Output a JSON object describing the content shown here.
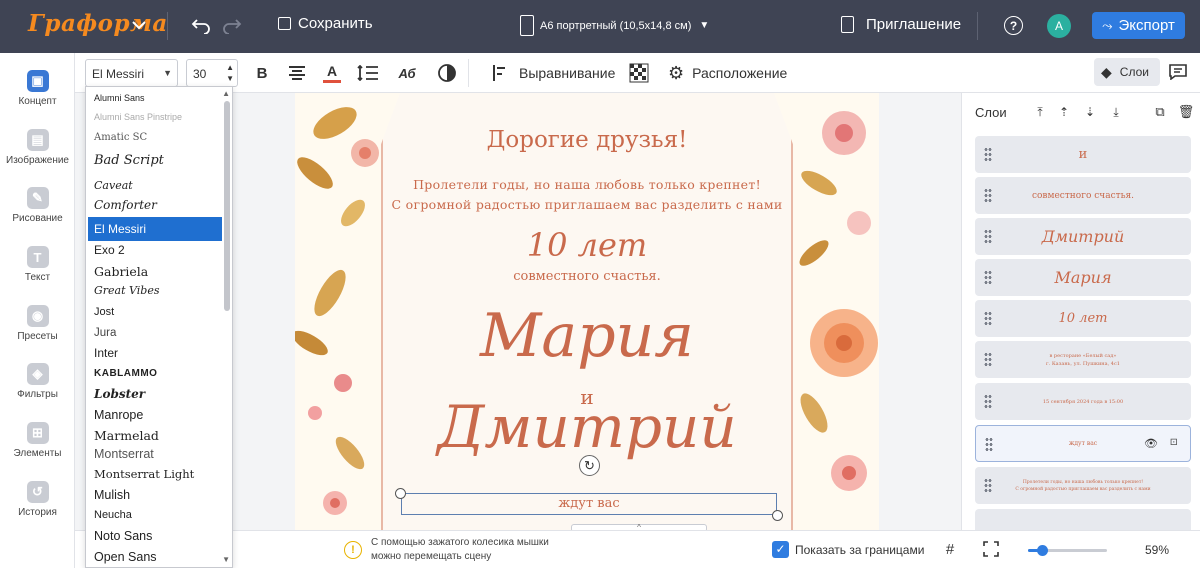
{
  "topbar": {
    "logo": "Граформа",
    "save_label": "Сохранить",
    "format_label": "А6 портретный (10,5х14,8 см)",
    "doc_name": "Приглашение",
    "help_glyph": "?",
    "avatar_letter": "A",
    "export_label": "Экспорт"
  },
  "toolbar": {
    "font_name": "El Messiri",
    "font_size": "30",
    "bold_glyph": "B",
    "align_label": "Выравнивание",
    "arrange_label": "Расположение",
    "layers_label": "Слои"
  },
  "leftnav": [
    {
      "label": "Концепт",
      "icon": "concept-icon"
    },
    {
      "label": "Изображение",
      "icon": "image-icon"
    },
    {
      "label": "Рисование",
      "icon": "draw-icon"
    },
    {
      "label": "Текст",
      "icon": "text-icon"
    },
    {
      "label": "Пресеты",
      "icon": "presets-icon"
    },
    {
      "label": "Фильтры",
      "icon": "filters-icon"
    },
    {
      "label": "Элементы",
      "icon": "elements-icon"
    },
    {
      "label": "История",
      "icon": "history-icon"
    }
  ],
  "font_list": [
    "Alumni Sans",
    "Alumni Sans Pinstripe",
    "Amatic SC",
    "Bad Script",
    "Caveat",
    "Comforter",
    "El Messiri",
    "Exo 2",
    "Gabriela",
    "Great Vibes",
    "Jost",
    "Jura",
    "Inter",
    "KABLAMMO",
    "Lobster",
    "Manrope",
    "Marmelad",
    "Montserrat",
    "Montserrat Light",
    "Mulish",
    "Neucha",
    "Noto Sans",
    "Open Sans"
  ],
  "font_selected_index": 6,
  "card": {
    "greeting": "Дорогие друзья!",
    "intro_line1": "Пролетели годы, но наша любовь только крепнет!",
    "intro_line2": "С огромной радостью приглашаем вас разделить с нами",
    "years": "10 лет",
    "together": "совместного счастья.",
    "name1": "Мария",
    "conj": "и",
    "name2": "Дмитрий",
    "waiting": "ждут вас"
  },
  "layers_panel": {
    "title": "Слои",
    "items": [
      {
        "text": "и"
      },
      {
        "text": "совместного счастья."
      },
      {
        "text": "Дмитрий"
      },
      {
        "text": "Мария"
      },
      {
        "text": "10 лет"
      },
      {
        "text": "в ресторане «Белый сад»\nг. Казань, ул. Пушкина, 4с1"
      },
      {
        "text": "15 сентября 2024 года в 15:00"
      },
      {
        "text": "ждут вас"
      },
      {
        "text": "Пролетели годы, но наша любовь только крепнет!\nС огромной радостью приглашаем вас разделить с нами"
      }
    ]
  },
  "bottombar": {
    "hint": "С помощью зажатого колесика мышки можно перемещать сцену",
    "show_outside_label": "Показать за границами",
    "zoom_label": "59%",
    "zoom_value": 0.59
  },
  "colors": {
    "accent": "#3a78d4",
    "text_terracotta": "#c96a4c",
    "topbar": "#3f4454"
  }
}
